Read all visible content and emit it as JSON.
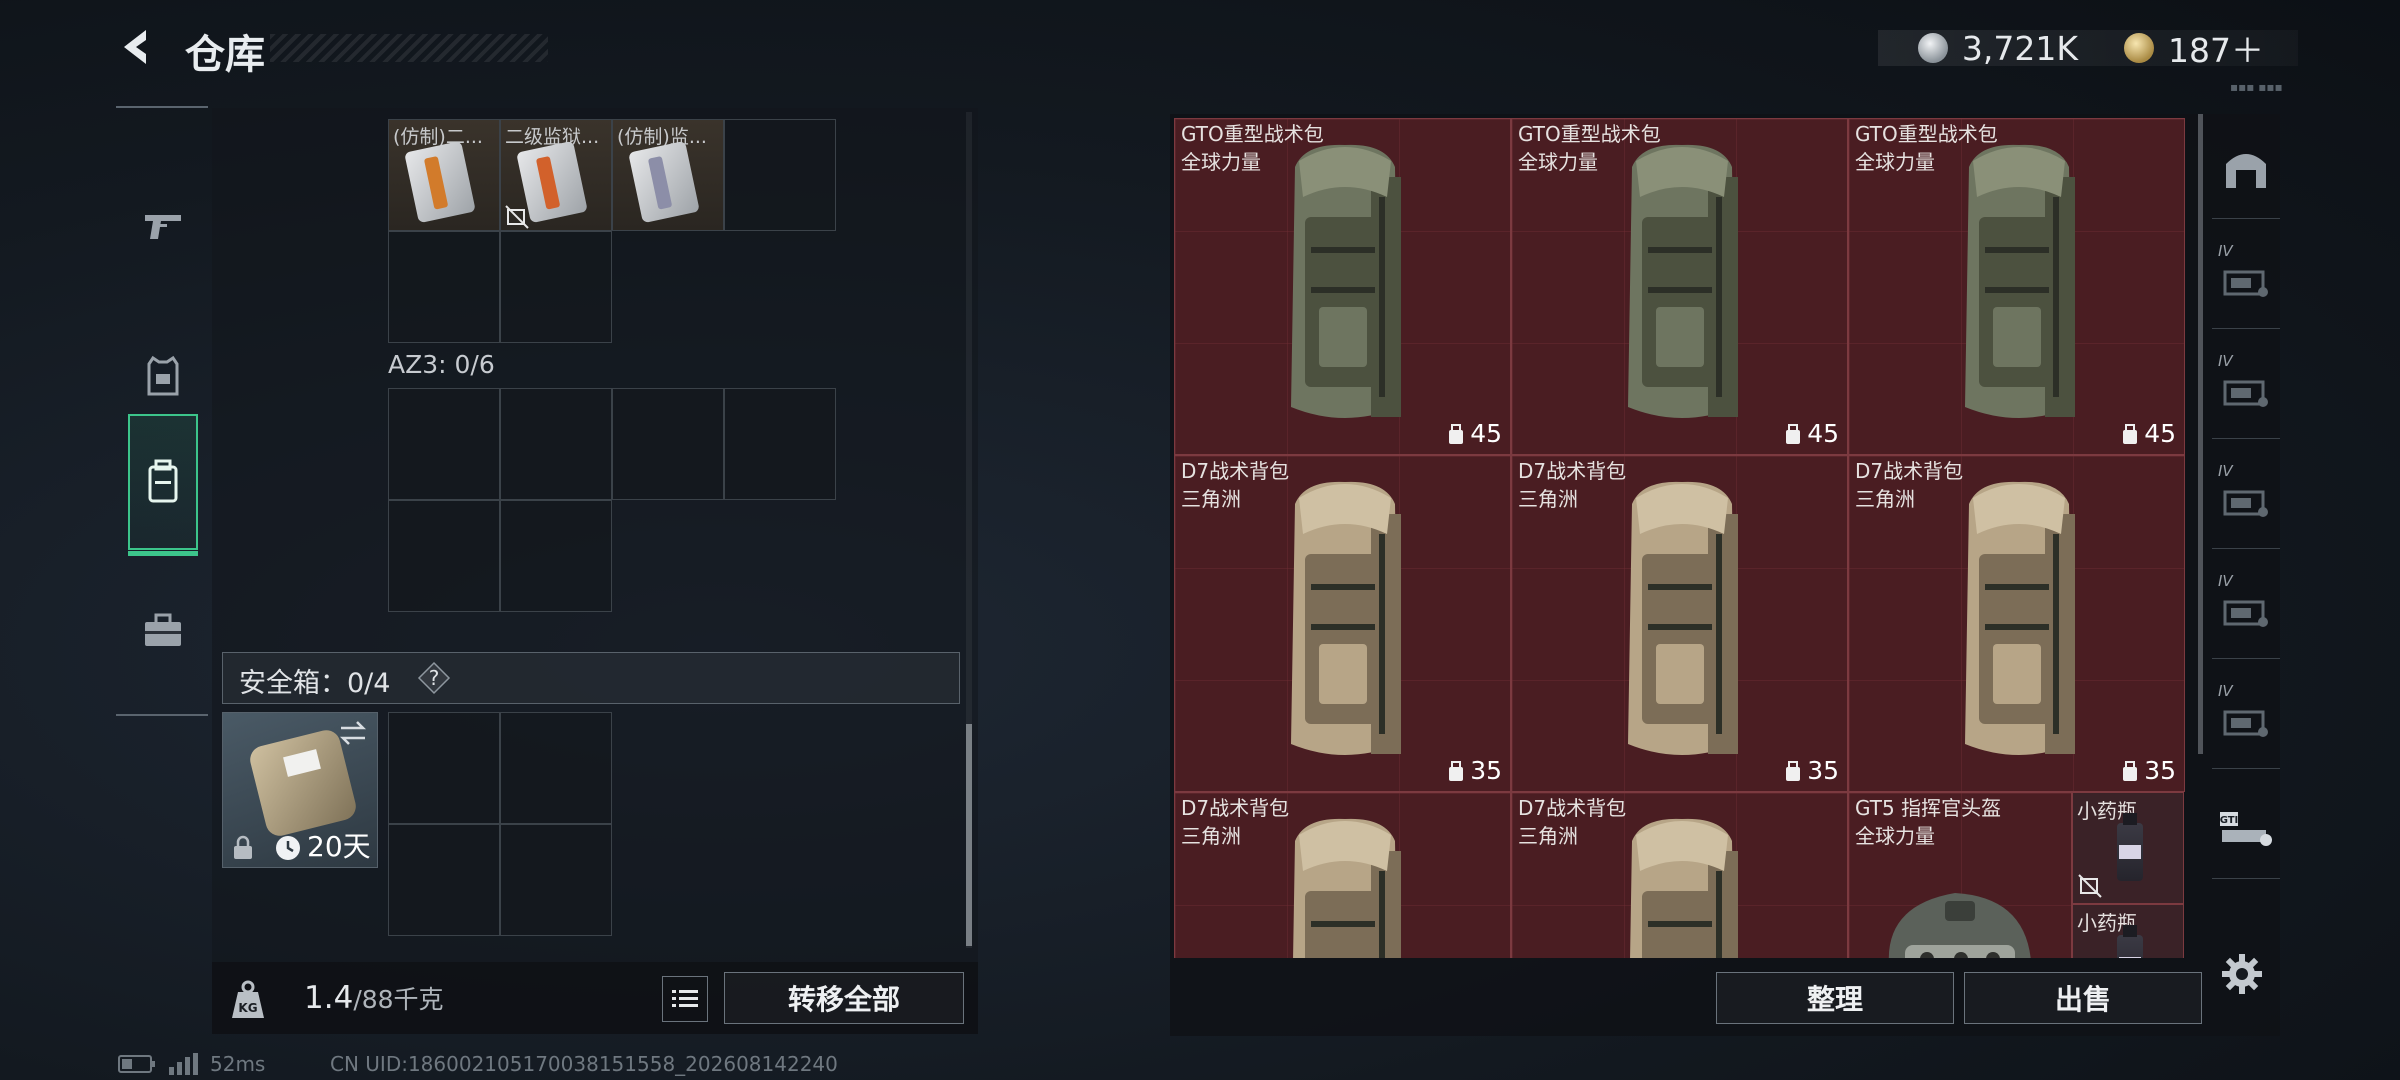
{
  "header": {
    "title": "仓库",
    "currency": [
      {
        "icon": "silver-coin-icon",
        "value": "3,721K"
      },
      {
        "icon": "gold-coin-icon",
        "value": "187＋"
      }
    ]
  },
  "tabs": [
    {
      "icon": "pistol-icon",
      "active": false
    },
    {
      "icon": "armor-vest-icon",
      "active": false
    },
    {
      "icon": "backpack-icon",
      "active": true
    },
    {
      "icon": "briefcase-icon",
      "active": false
    }
  ],
  "left_panel": {
    "top_items": [
      {
        "name": "(仿制)二..."
      },
      {
        "name": "二级监狱..."
      },
      {
        "name": "(仿制)监..."
      }
    ],
    "az3_label": "AZ3: 0/6",
    "safebox_label": "安全箱：0/4",
    "safebox_help": "?",
    "case_days": "20天",
    "weight": {
      "value": "1.4",
      "unit": "/88千克"
    },
    "transfer_all": "转移全部"
  },
  "grid_items": [
    {
      "name": "GTO重型战术包",
      "sub": "全球力量",
      "cap": "45",
      "type": "green-bag"
    },
    {
      "name": "GTO重型战术包",
      "sub": "全球力量",
      "cap": "45",
      "type": "green-bag"
    },
    {
      "name": "GTO重型战术包",
      "sub": "全球力量",
      "cap": "45",
      "type": "green-bag"
    },
    {
      "name": "D7战术背包",
      "sub": "三角洲",
      "cap": "35",
      "type": "tan-bag"
    },
    {
      "name": "D7战术背包",
      "sub": "三角洲",
      "cap": "35",
      "type": "tan-bag"
    },
    {
      "name": "D7战术背包",
      "sub": "三角洲",
      "cap": "35",
      "type": "tan-bag"
    },
    {
      "name": "D7战术背包",
      "sub": "三角洲",
      "cap": "",
      "type": "tan-bag"
    },
    {
      "name": "D7战术背包",
      "sub": "三角洲",
      "cap": "",
      "type": "tan-bag"
    },
    {
      "name": "GT5 指挥官头盔",
      "sub": "全球力量",
      "cap": "",
      "type": "helmet"
    }
  ],
  "small_items": [
    {
      "name": "小药瓶"
    },
    {
      "name": "小药瓶"
    }
  ],
  "actions": {
    "sort": "整理",
    "sell": "出售"
  },
  "rail": [
    {
      "label": "",
      "icon": "storage-home-icon"
    },
    {
      "label": "IV",
      "icon": "storage-level-icon"
    },
    {
      "label": "IV",
      "icon": "storage-level-icon"
    },
    {
      "label": "IV",
      "icon": "storage-level-icon"
    },
    {
      "label": "IV",
      "icon": "storage-level-icon"
    },
    {
      "label": "IV",
      "icon": "storage-level-icon"
    },
    {
      "label": "GTI",
      "icon": "storage-gti-icon"
    }
  ],
  "status": {
    "ping": "52ms",
    "uid": "CN UID:186002105170038151558_202608142240"
  },
  "colors": {
    "accent": "#3cc58b",
    "item_bg": "#4a1d22",
    "item_border": "#7c3a40"
  }
}
